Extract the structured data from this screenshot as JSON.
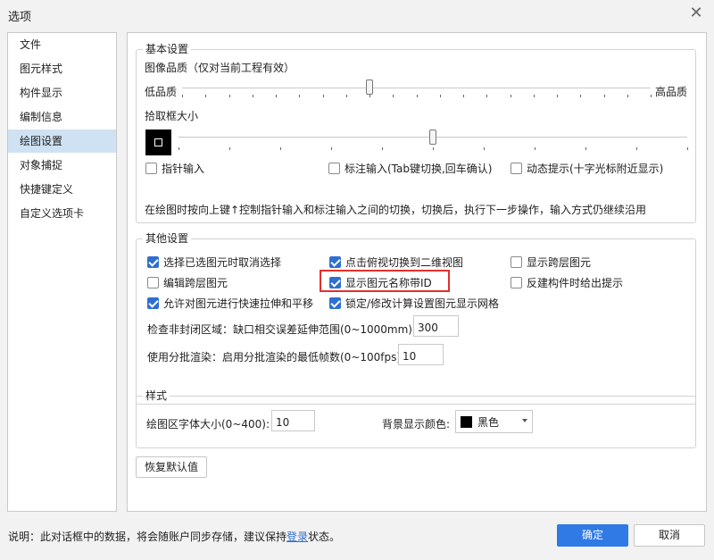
{
  "window": {
    "title": "选项",
    "close_glyph": "✕"
  },
  "nav": {
    "items": [
      "文件",
      "图元样式",
      "构件显示",
      "编制信息",
      "绘图设置",
      "对象捕捉",
      "快捷键定义",
      "自定义选项卡"
    ],
    "active": "绘图设置"
  },
  "basic": {
    "legend": "基本设置",
    "quality_label": "图像品质（仅对当前工程有效）",
    "low": "低品质",
    "high": "高品质",
    "quality_ticks": 21,
    "quality_level": 0.4,
    "pickbox_label": "拾取框大小",
    "pickbox_ticks": 11,
    "pickbox_level": 0.5,
    "check_pointer": {
      "label": "指针输入",
      "checked": false
    },
    "check_annot": {
      "label": "标注输入(Tab键切换,回车确认)",
      "checked": false
    },
    "check_dynamic": {
      "label": "动态提示(十字光标附近显示)",
      "checked": false
    },
    "hint": "在绘图时按向上键↑控制指针输入和标注输入之间的切换，切换后，执行下一步操作，输入方式仍继续沿用"
  },
  "other": {
    "legend": "其他设置",
    "checks": [
      {
        "label": "选择已选图元时取消选择",
        "checked": true
      },
      {
        "label": "点击俯视切换到二维视图",
        "checked": true
      },
      {
        "label": "显示跨层图元",
        "checked": false
      },
      {
        "label": "编辑跨层图元",
        "checked": false
      },
      {
        "label": "显示图元名称带ID",
        "checked": true
      },
      {
        "label": "反建构件时给出提示",
        "checked": false
      },
      {
        "label": "允许对图元进行快速拉伸和平移",
        "checked": true
      },
      {
        "label": "锁定/修改计算设置图元显示网格",
        "checked": true
      }
    ],
    "gap_label": "检查非封闭区域：缺口相交误差延伸范围(0~1000mm):",
    "gap_value": "300",
    "fps_label": "使用分批渲染：启用分批渲染的最低帧数(0~100fps):",
    "fps_value": "10"
  },
  "style": {
    "legend": "样式",
    "font_label": "绘图区字体大小(0~400):",
    "font_value": "10",
    "bg_label": "背景显示颜色:",
    "bg_value": "黑色",
    "bg_color": "#000000"
  },
  "restore_label": "恢复默认值",
  "footer": {
    "note_prefix": "说明：此对话框中的数据，将会随账户同步存储，建议保持",
    "note_link": "登录",
    "note_suffix": "状态。"
  },
  "ok_label": "确定",
  "cancel_label": "取消",
  "colors": {
    "accent": "#2f7ae5",
    "highlight": "#e0312b",
    "nav_active": "#cfe2f3"
  }
}
